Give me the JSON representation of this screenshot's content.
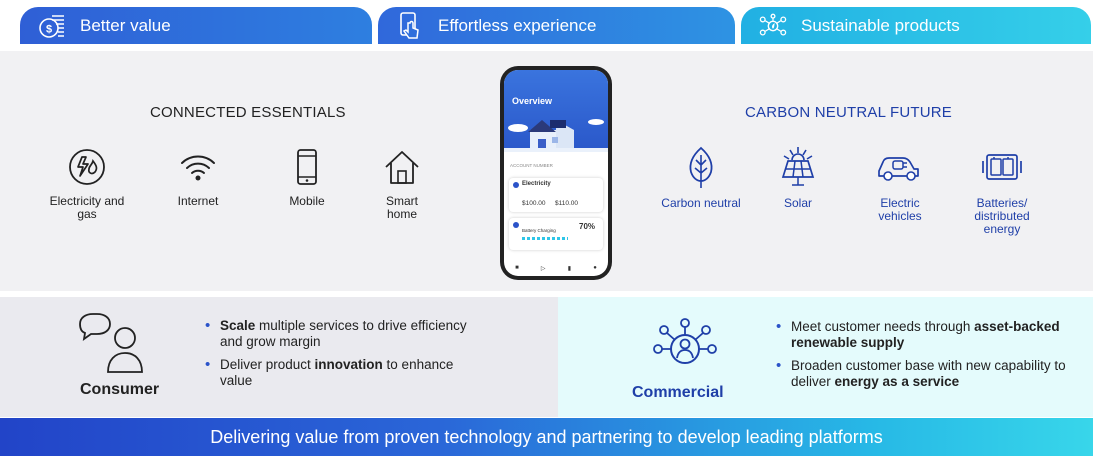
{
  "tabs": [
    {
      "label": "Better value",
      "icon": "coins-icon"
    },
    {
      "label": "Effortless experience",
      "icon": "phone-tap-icon"
    },
    {
      "label": "Sustainable products",
      "icon": "network-leaf-icon"
    }
  ],
  "connected": {
    "title": "CONNECTED ESSENTIALS",
    "items": [
      {
        "label": "Electricity and gas",
        "icon": "bolt-flame-icon"
      },
      {
        "label": "Internet",
        "icon": "wifi-icon"
      },
      {
        "label": "Mobile",
        "icon": "mobile-icon"
      },
      {
        "label": "Smart home",
        "icon": "house-icon"
      }
    ]
  },
  "carbon": {
    "title": "CARBON NEUTRAL FUTURE",
    "items": [
      {
        "label": "Carbon neutral",
        "icon": "leaf-icon"
      },
      {
        "label": "Solar",
        "icon": "solar-panel-icon"
      },
      {
        "label": "Electric vehicles",
        "icon": "ev-car-icon"
      },
      {
        "label": "Batteries/ distributed energy",
        "icon": "battery-icon"
      }
    ]
  },
  "phone": {
    "screen_title": "Overview",
    "account_label": "ACCOUNT NUMBER",
    "electricity_label": "Electricity",
    "amount1": "$100.00",
    "amount2": "$110.00",
    "battery_label": "Battery Charging",
    "battery_pct": "70%"
  },
  "consumer": {
    "label": "Consumer",
    "bullets": [
      {
        "bold": "Scale",
        "rest": " multiple services to drive efficiency and grow margin"
      },
      {
        "pre": "Deliver product ",
        "bold": "innovation",
        "post": " to enhance value"
      }
    ]
  },
  "commercial": {
    "label": "Commercial",
    "bullets": [
      {
        "pre": "Meet customer needs through ",
        "bold": "asset-backed renewable supply"
      },
      {
        "pre": "Broaden customer base with new capability to deliver ",
        "bold": "energy as a service"
      }
    ]
  },
  "banner": "Delivering value from proven technology and partnering to develop leading platforms",
  "colors": {
    "accent_dark": "#1f3fa8",
    "accent_blue": "#2b53c9",
    "accent_cyan": "#2ec6e8"
  }
}
